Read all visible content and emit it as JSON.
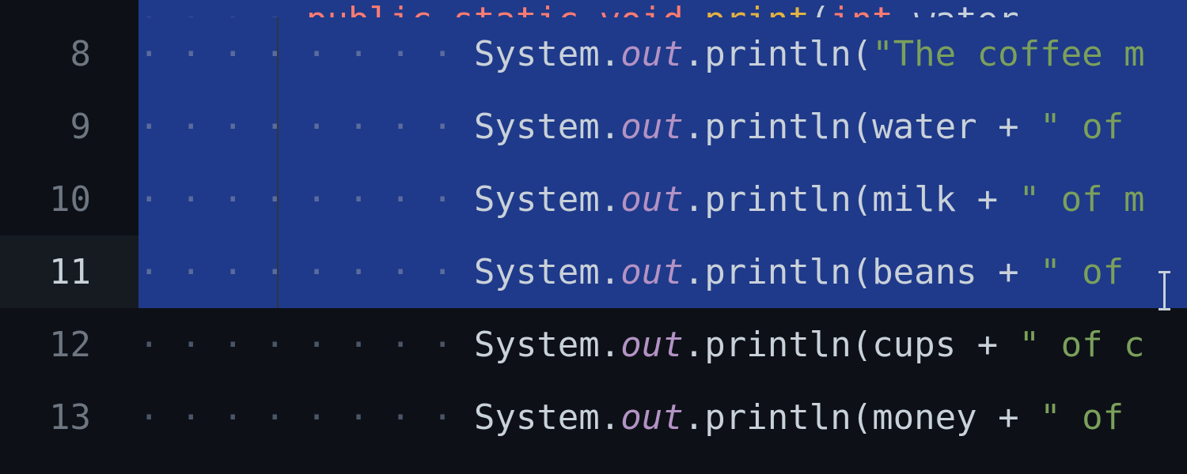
{
  "editor": {
    "indent_dots_8": "· · · · · · · · ",
    "indent_dots_4": "· · · · ",
    "lines": [
      {
        "num": "",
        "selected": true,
        "current": false,
        "partial_top": true,
        "tokens": [
          {
            "cls": "tok-keyword",
            "text": "public static void "
          },
          {
            "cls": "tok-funcname",
            "text": "print"
          },
          {
            "cls": "tok-paren",
            "text": "("
          },
          {
            "cls": "tok-type",
            "text": "int "
          },
          {
            "cls": "tok-ident",
            "text": "water,"
          }
        ]
      },
      {
        "num": "8",
        "selected": true,
        "current": false,
        "tokens": [
          {
            "cls": "tok-default",
            "text": "System."
          },
          {
            "cls": "tok-field",
            "text": "out"
          },
          {
            "cls": "tok-default",
            "text": ".println("
          },
          {
            "cls": "tok-string",
            "text": "\"The coffee m"
          }
        ]
      },
      {
        "num": "9",
        "selected": true,
        "current": false,
        "tokens": [
          {
            "cls": "tok-default",
            "text": "System."
          },
          {
            "cls": "tok-field",
            "text": "out"
          },
          {
            "cls": "tok-default",
            "text": ".println(water + "
          },
          {
            "cls": "tok-string",
            "text": "\" of "
          }
        ]
      },
      {
        "num": "10",
        "selected": true,
        "current": false,
        "tokens": [
          {
            "cls": "tok-default",
            "text": "System."
          },
          {
            "cls": "tok-field",
            "text": "out"
          },
          {
            "cls": "tok-default",
            "text": ".println(milk + "
          },
          {
            "cls": "tok-string",
            "text": "\" of m"
          }
        ]
      },
      {
        "num": "11",
        "selected": true,
        "current": true,
        "tokens": [
          {
            "cls": "tok-default",
            "text": "System."
          },
          {
            "cls": "tok-field",
            "text": "out"
          },
          {
            "cls": "tok-default",
            "text": ".println(beans + "
          },
          {
            "cls": "tok-string",
            "text": "\" of "
          }
        ]
      },
      {
        "num": "12",
        "selected": false,
        "current": false,
        "tokens": [
          {
            "cls": "tok-default",
            "text": "System."
          },
          {
            "cls": "tok-field",
            "text": "out"
          },
          {
            "cls": "tok-default",
            "text": ".println(cups + "
          },
          {
            "cls": "tok-string",
            "text": "\" of c"
          }
        ]
      },
      {
        "num": "13",
        "selected": false,
        "current": false,
        "tokens": [
          {
            "cls": "tok-default",
            "text": "System."
          },
          {
            "cls": "tok-field",
            "text": "out"
          },
          {
            "cls": "tok-default",
            "text": ".println(money + "
          },
          {
            "cls": "tok-string",
            "text": "\" of "
          }
        ]
      }
    ]
  },
  "colors": {
    "selection": "#1f3a8a",
    "background": "#0d1117",
    "currentLine": "#161b22"
  }
}
